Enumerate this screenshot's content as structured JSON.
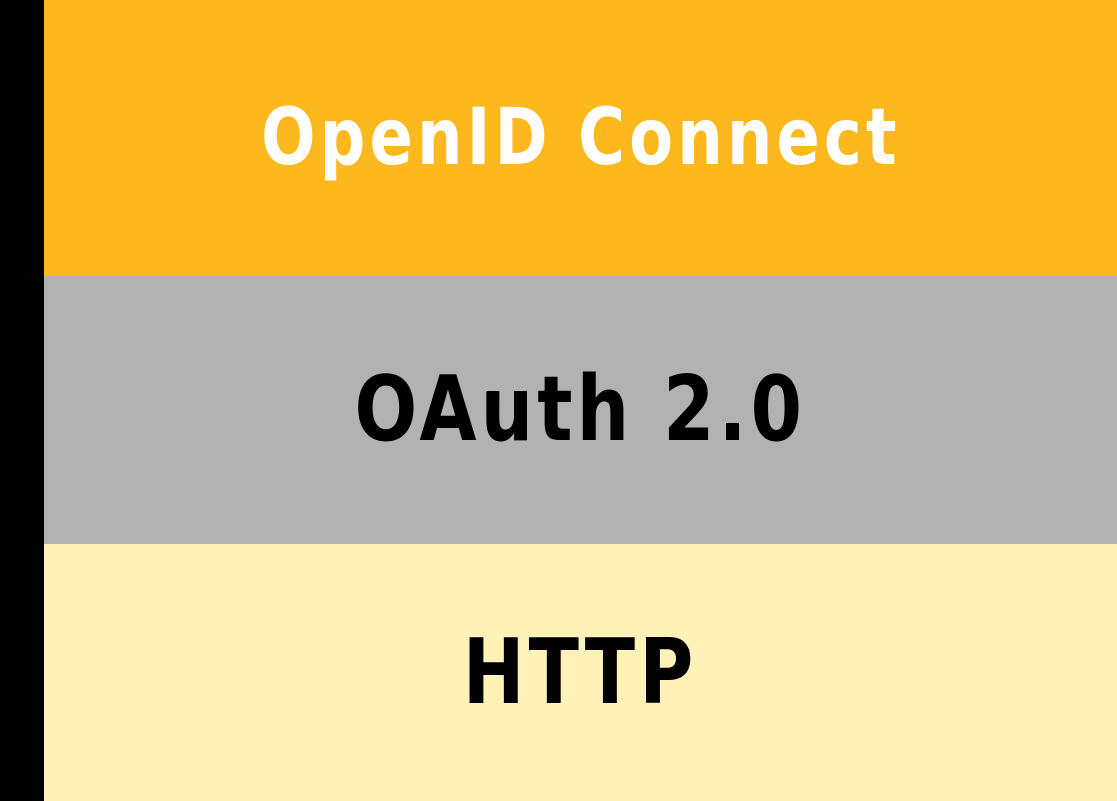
{
  "stack": {
    "layers": [
      {
        "label": "OpenID Connect",
        "background": "#FDB81E",
        "text_color": "#FFFFFF"
      },
      {
        "label": "OAuth 2.0",
        "background": "#B2B2B2",
        "text_color": "#000000"
      },
      {
        "label": "HTTP",
        "background": "#FFF2B9",
        "text_color": "#000000"
      }
    ]
  },
  "colors": {
    "backdrop": "#000000"
  }
}
